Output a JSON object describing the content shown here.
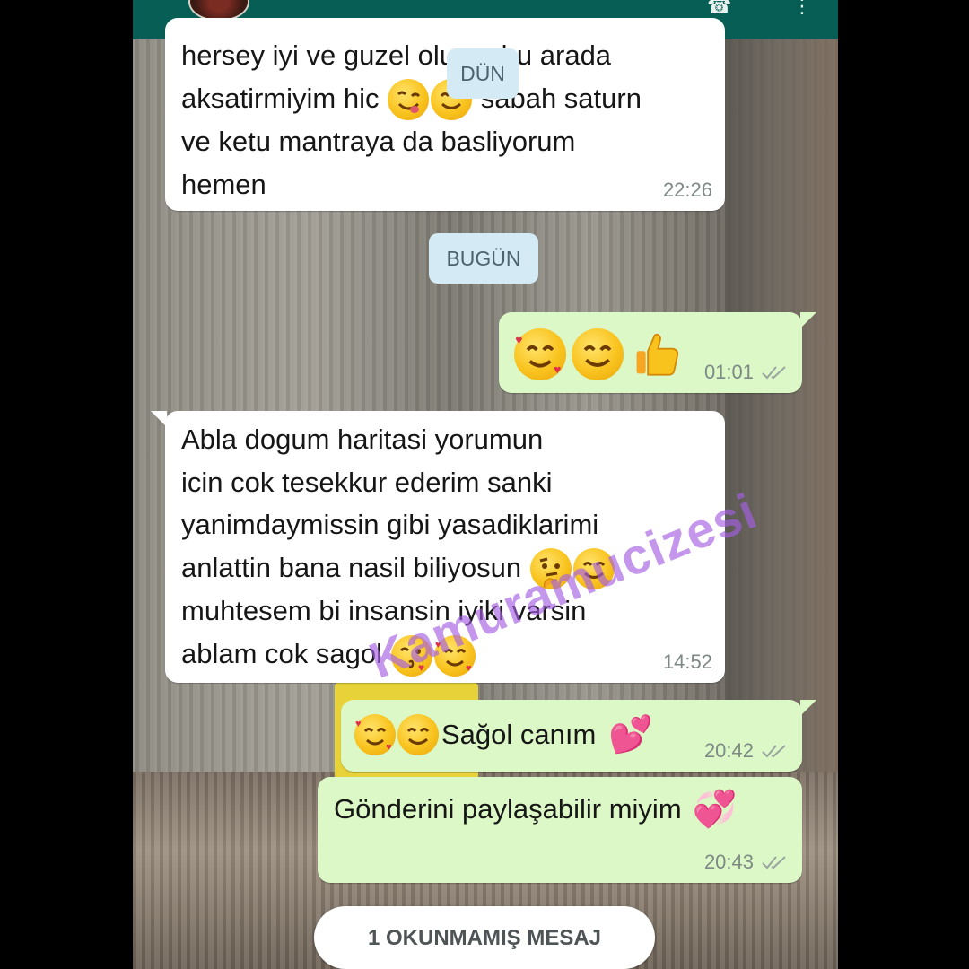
{
  "header": {
    "avatar_icon": "contact-avatar",
    "icons": [
      "call-icon",
      "menu-icon"
    ]
  },
  "messages": [
    {
      "direction": "incoming",
      "lines": [
        "hersey iyi ve guzel oluyor bu arada",
        "aksatirmiyim hic",
        "ve ketu mantraya da basliyorum",
        "hemen"
      ],
      "inline_after_line2": "sabah saturn",
      "emojis": [
        "face-savoring-food",
        "smiling-face"
      ],
      "time": "22:26"
    },
    {
      "direction": "outgoing",
      "emojis": [
        "smiling-face-with-hearts",
        "smiling-face",
        "thumbs-up"
      ],
      "time": "01:01"
    },
    {
      "direction": "incoming",
      "lines": [
        "Abla dogum haritasi yorumun",
        "icin cok tesekkur ederim sanki",
        "yanimdaymissin gibi yasadiklarimi",
        "anlattin bana nasil biliyosun",
        "muhtesem bi insansin iyiki varsin",
        "ablam cok sagol"
      ],
      "emojis_line4": [
        "thinking-face",
        "smiling-face"
      ],
      "emojis_line6": [
        "face-blowing-kiss",
        "smiling-face-with-hearts"
      ],
      "time": "14:52"
    },
    {
      "direction": "outgoing",
      "text": "Sağol canım",
      "emojis_before": [
        "smiling-face-with-hearts",
        "smiling-face"
      ],
      "emoji_after": "two-hearts",
      "time": "20:42"
    },
    {
      "direction": "outgoing",
      "text": "Gönderini paylaşabilir miyim",
      "emoji_after": "revolving-hearts",
      "time": "20:43"
    }
  ],
  "date_labels": {
    "yesterday": "DÜN",
    "today": "BUGÜN"
  },
  "unread_banner": "1 OKUNMAMIŞ MESAJ",
  "watermark": "Kamuramucizesi",
  "colors": {
    "header": "#075e54",
    "incoming": "#ffffff",
    "outgoing": "#dcf8c6",
    "date_pill": "#d4eaf4",
    "read_ticks": "#9aa5a0"
  }
}
